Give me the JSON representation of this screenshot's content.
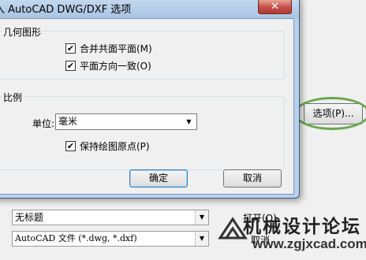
{
  "dialog": {
    "title": "入 AutoCAD DWG/DXF 选项",
    "close_glyph": "✕",
    "geometry_group": {
      "label": "几何图形",
      "options": [
        {
          "label": "合并共面平面(M)",
          "checked": true
        },
        {
          "label": "平面方向一致(O)",
          "checked": true
        }
      ]
    },
    "scale_group": {
      "label": "比例",
      "unit_label": "单位:",
      "unit_value": "毫米",
      "keep_origin": {
        "label": "保持绘图原点(P)",
        "checked": true
      }
    },
    "ok_label": "确定",
    "cancel_label": "取消"
  },
  "parent": {
    "options_button": "选项(P)...",
    "title_combo": "无标题",
    "filetype_combo": "AutoCAD 文件 (*.dwg, *.dxf)",
    "open_button": "打开(O)",
    "cancel_button": "取消"
  },
  "icons": {
    "check": "✔",
    "dropdown": "▼",
    "arrow_color": "#4a7bc8",
    "ring_color": "#6aa84f"
  },
  "watermark": {
    "title": "机械设计论坛",
    "url": "www.zgjxcad.com"
  }
}
